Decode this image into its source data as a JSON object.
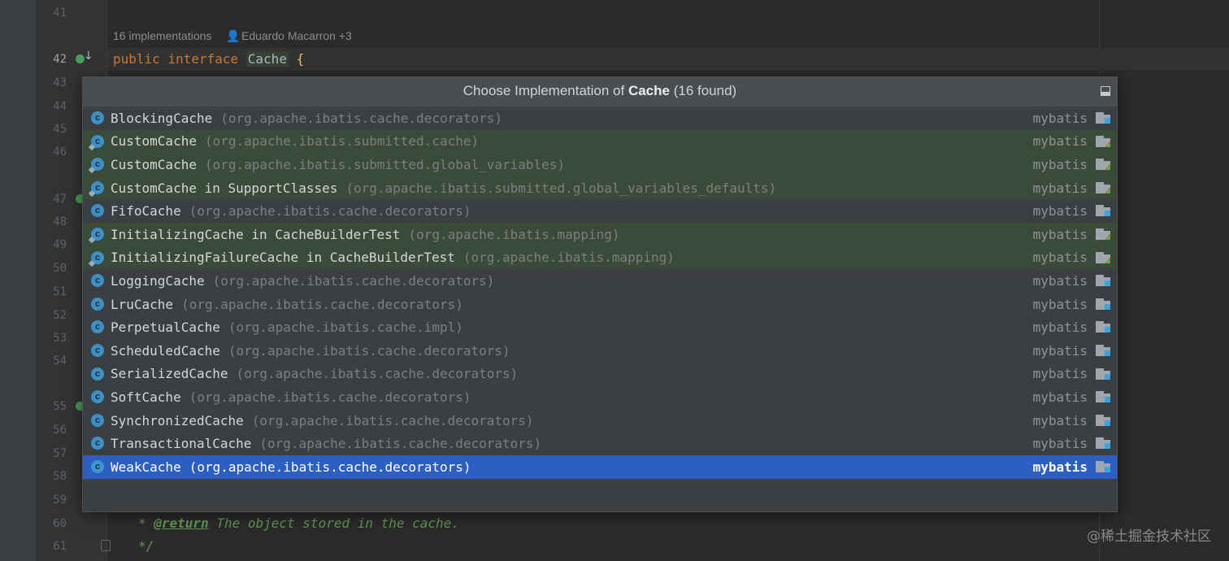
{
  "editor": {
    "line_numbers": [
      "41",
      "42",
      "43",
      "44",
      "45",
      "46",
      "47",
      "48",
      "49",
      "50",
      "51",
      "52",
      "53",
      "54",
      "55",
      "56",
      "57",
      "58",
      "59",
      "60",
      "61"
    ],
    "inlay_hint": {
      "implementations": "16 implementations",
      "author": "Eduardo Macarron +3"
    },
    "code_line": {
      "keyword_public": "public",
      "keyword_interface": "interface",
      "name": "Cache",
      "brace": "{"
    },
    "doc_lines": {
      "return_prefix": "* ",
      "return_tag": "@return",
      "return_text": " The object stored in the cache.",
      "close": "*/"
    }
  },
  "popup": {
    "title_prefix": "Choose Implementation of ",
    "title_bold": "Cache",
    "title_suffix": " (16 found)",
    "items": [
      {
        "name": "BlockingCache",
        "package": "(org.apache.ibatis.cache.decorators)",
        "module": "mybatis",
        "test": false
      },
      {
        "name": "CustomCache",
        "package": "(org.apache.ibatis.submitted.cache)",
        "module": "mybatis",
        "test": true
      },
      {
        "name": "CustomCache",
        "package": "(org.apache.ibatis.submitted.global_variables)",
        "module": "mybatis",
        "test": true
      },
      {
        "name": "CustomCache in SupportClasses",
        "package": "(org.apache.ibatis.submitted.global_variables_defaults)",
        "module": "mybatis",
        "test": true
      },
      {
        "name": "FifoCache",
        "package": "(org.apache.ibatis.cache.decorators)",
        "module": "mybatis",
        "test": false
      },
      {
        "name": "InitializingCache in CacheBuilderTest",
        "package": "(org.apache.ibatis.mapping)",
        "module": "mybatis",
        "test": true
      },
      {
        "name": "InitializingFailureCache in CacheBuilderTest",
        "package": "(org.apache.ibatis.mapping)",
        "module": "mybatis",
        "test": true
      },
      {
        "name": "LoggingCache",
        "package": "(org.apache.ibatis.cache.decorators)",
        "module": "mybatis",
        "test": false
      },
      {
        "name": "LruCache",
        "package": "(org.apache.ibatis.cache.decorators)",
        "module": "mybatis",
        "test": false
      },
      {
        "name": "PerpetualCache",
        "package": "(org.apache.ibatis.cache.impl)",
        "module": "mybatis",
        "test": false
      },
      {
        "name": "ScheduledCache",
        "package": "(org.apache.ibatis.cache.decorators)",
        "module": "mybatis",
        "test": false
      },
      {
        "name": "SerializedCache",
        "package": "(org.apache.ibatis.cache.decorators)",
        "module": "mybatis",
        "test": false
      },
      {
        "name": "SoftCache",
        "package": "(org.apache.ibatis.cache.decorators)",
        "module": "mybatis",
        "test": false
      },
      {
        "name": "SynchronizedCache",
        "package": "(org.apache.ibatis.cache.decorators)",
        "module": "mybatis",
        "test": false
      },
      {
        "name": "TransactionalCache",
        "package": "(org.apache.ibatis.cache.decorators)",
        "module": "mybatis",
        "test": false
      },
      {
        "name": "WeakCache",
        "package": "(org.apache.ibatis.cache.decorators)",
        "module": "mybatis",
        "test": false,
        "selected": true
      }
    ]
  },
  "watermark": "@稀土掘金技术社区",
  "colors": {
    "editor_bg": "#2b2b2b",
    "popup_bg": "#3c3f41",
    "test_row_bg": "#3a4b3a",
    "selection_bg": "#2d5fc2",
    "keyword": "#cc7832",
    "doc_comment": "#629755",
    "class_icon": "#3d8fc4"
  }
}
